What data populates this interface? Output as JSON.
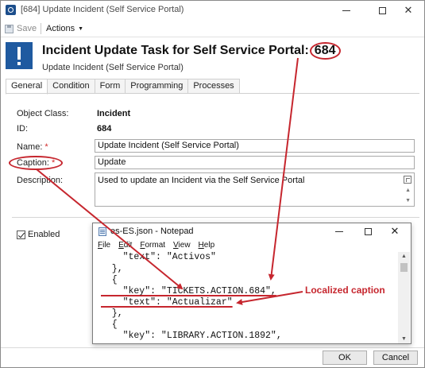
{
  "window": {
    "title": "[684] Update Incident (Self Service Portal)"
  },
  "toolbar": {
    "save_label": "Save",
    "actions_label": "Actions"
  },
  "header": {
    "title_text": "Incident Update Task for Self Service Portal:",
    "title_id": "684",
    "subtitle": "Update Incident (Self Service Portal)"
  },
  "tabs": [
    {
      "label": "General",
      "active": true
    },
    {
      "label": "Condition"
    },
    {
      "label": "Form"
    },
    {
      "label": "Programming"
    },
    {
      "label": "Processes"
    }
  ],
  "form": {
    "object_class": {
      "label": "Object Class:",
      "value": "Incident"
    },
    "id": {
      "label": "ID:",
      "value": "684"
    },
    "name": {
      "label": "Name:",
      "required_mark": "*",
      "value": "Update Incident (Self Service Portal)"
    },
    "caption": {
      "label": "Caption:",
      "required_mark": "*",
      "value": "Update"
    },
    "description": {
      "label": "Description:",
      "value": "Used to update an Incident via the Self Service Portal"
    },
    "enabled": {
      "label": "Enabled",
      "checked": true
    }
  },
  "footer": {
    "ok_label": "OK",
    "cancel_label": "Cancel"
  },
  "notepad": {
    "title": "es-ES.json - Notepad",
    "menu": [
      "File",
      "Edit",
      "Format",
      "View",
      "Help"
    ],
    "lines": [
      "    \"text\": \"Activos\"",
      "  },",
      "  {",
      "    \"key\": \"TICKETS.ACTION.684\",",
      "    \"text\": \"Actualizar\"",
      "  },",
      "  {",
      "    \"key\": \"LIBRARY.ACTION.1892\","
    ]
  },
  "annotation": {
    "text": "Localized caption",
    "color": "#c6262e"
  },
  "colors": {
    "accent_blue": "#1f5aa0",
    "annotation_red": "#c6262e"
  }
}
